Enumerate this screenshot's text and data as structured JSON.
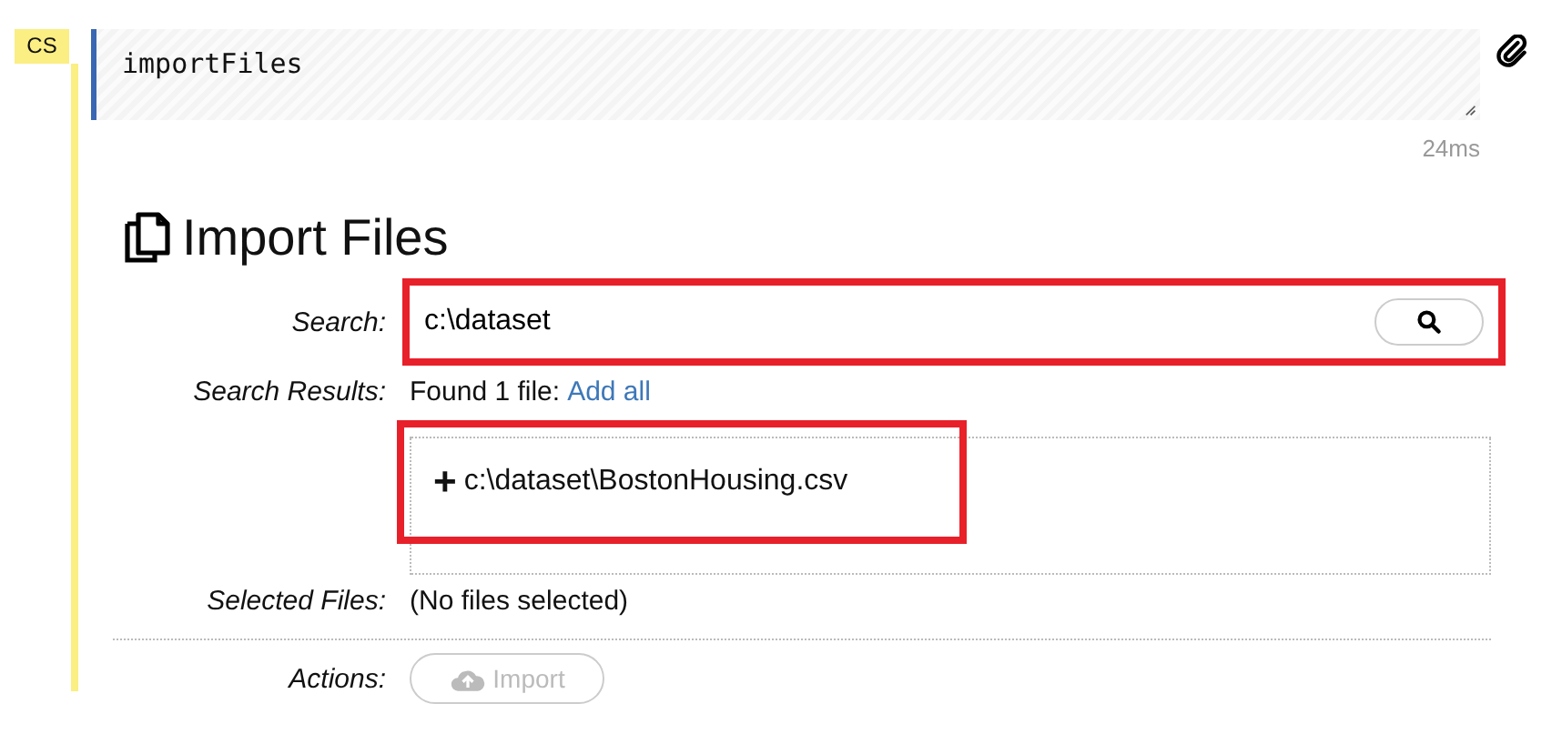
{
  "cell": {
    "badge": "CS",
    "code": "importFiles",
    "timing": "24ms"
  },
  "output": {
    "title": "Import Files",
    "search": {
      "label": "Search:",
      "value": "c:\\dataset",
      "highlighted": true
    },
    "results": {
      "label": "Search Results:",
      "summary": "Found 1 file:",
      "link": "Add all",
      "items": [
        {
          "icon": "+",
          "path": "c:\\dataset\\BostonHousing.csv",
          "highlighted": true
        }
      ]
    },
    "selected": {
      "label": "Selected Files:",
      "value": "(No files selected)"
    },
    "actions": {
      "label": "Actions:",
      "buttons": [
        {
          "label": "Import",
          "disabled": true
        }
      ]
    }
  }
}
